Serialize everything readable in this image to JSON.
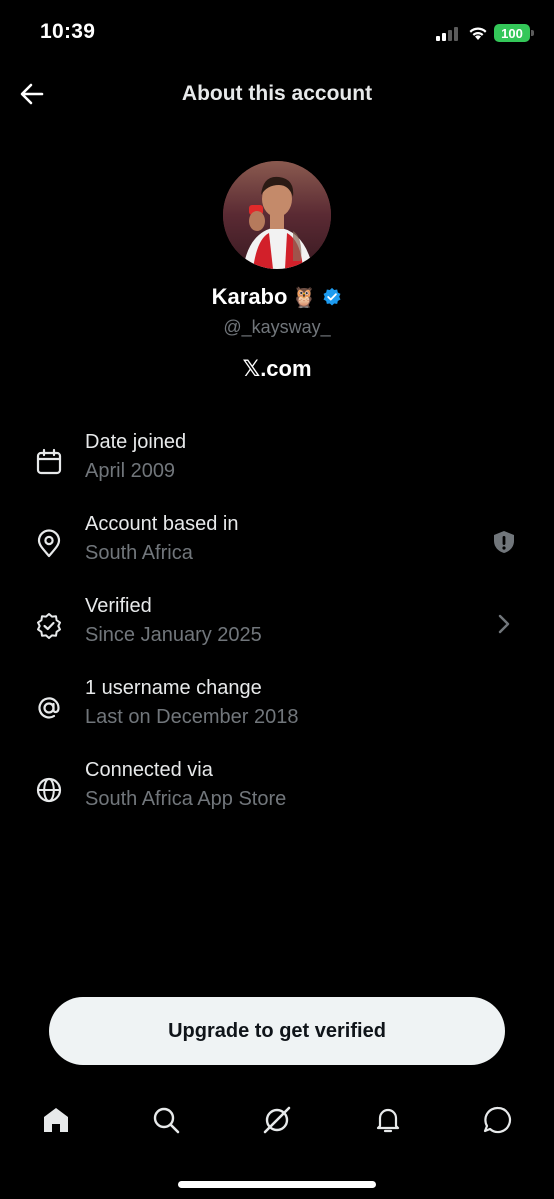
{
  "status_bar": {
    "time": "10:39",
    "battery": "100"
  },
  "header": {
    "title": "About this account",
    "back_icon": "arrow-left-icon"
  },
  "profile": {
    "name": "Karabo",
    "name_emoji": "🦉",
    "handle": "@_kaysway_",
    "platform_mark": "𝕏",
    "platform_suffix": ".com",
    "verified_color": "#1d9bf0"
  },
  "info_items": [
    {
      "icon": "calendar-icon",
      "title": "Date joined",
      "subtitle": "April 2009"
    },
    {
      "icon": "location-pin-icon",
      "title": "Account based in",
      "subtitle": "South Africa",
      "action_icon": "shield-alert-icon"
    },
    {
      "icon": "verified-badge-outline-icon",
      "title": "Verified",
      "subtitle": "Since January 2025",
      "action_icon": "chevron-right-icon"
    },
    {
      "icon": "at-sign-icon",
      "title": "1 username change",
      "subtitle": "Last on December 2018"
    },
    {
      "icon": "globe-icon",
      "title": "Connected via",
      "subtitle": "South Africa App Store"
    }
  ],
  "cta": {
    "label": "Upgrade to get verified"
  },
  "bottom_nav": [
    "home-icon",
    "search-icon",
    "grok-icon",
    "bell-icon",
    "messages-icon"
  ],
  "colors": {
    "background": "#000000",
    "text": "#e7e9ea",
    "muted": "#71767b",
    "cta_bg": "#eff3f4",
    "battery": "#34c759"
  }
}
